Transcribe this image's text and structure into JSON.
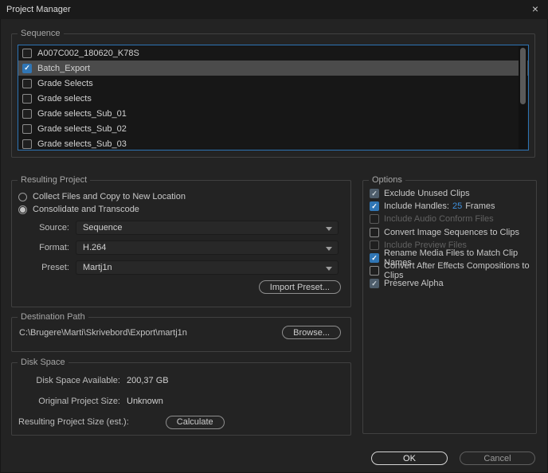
{
  "window": {
    "title": "Project Manager",
    "close_icon": "×"
  },
  "colors": {
    "accent": "#3076b5",
    "hot_text": "#3f90dd",
    "background": "#232323"
  },
  "sequence": {
    "label": "Sequence",
    "items": [
      {
        "label": "A007C002_180620_K78S",
        "checked": false,
        "selected": false
      },
      {
        "label": "Batch_Export",
        "checked": true,
        "selected": true
      },
      {
        "label": "Grade Selects",
        "checked": false,
        "selected": false
      },
      {
        "label": "Grade selects",
        "checked": false,
        "selected": false
      },
      {
        "label": "Grade selects_Sub_01",
        "checked": false,
        "selected": false
      },
      {
        "label": "Grade selects_Sub_02",
        "checked": false,
        "selected": false
      },
      {
        "label": "Grade selects_Sub_03",
        "checked": false,
        "selected": false
      }
    ]
  },
  "resulting_project": {
    "label": "Resulting Project",
    "radios": [
      {
        "label": "Collect Files and Copy to New Location",
        "selected": false
      },
      {
        "label": "Consolidate and Transcode",
        "selected": true
      }
    ],
    "fields": [
      {
        "label": "Source:",
        "value": "Sequence"
      },
      {
        "label": "Format:",
        "value": "H.264"
      },
      {
        "label": "Preset:",
        "value": "Martj1n"
      }
    ],
    "import_preset_label": "Import Preset..."
  },
  "options": {
    "label": "Options",
    "items": [
      {
        "label": "Exclude Unused Clips",
        "checked": true,
        "disabled": true
      },
      {
        "label": "Include Handles:",
        "checked": true,
        "disabled": false,
        "value": "25",
        "suffix": "Frames"
      },
      {
        "label": "Include Audio Conform Files",
        "checked": false,
        "disabled": true
      },
      {
        "label": "Convert Image Sequences to Clips",
        "checked": false,
        "disabled": false
      },
      {
        "label": "Include Preview Files",
        "checked": false,
        "disabled": true
      },
      {
        "label": "Rename Media Files to Match Clip Names",
        "checked": true,
        "disabled": false
      },
      {
        "label": "Convert After Effects Compositions to Clips",
        "checked": false,
        "disabled": false
      },
      {
        "label": "Preserve Alpha",
        "checked": true,
        "disabled": true
      }
    ]
  },
  "destination_path": {
    "label": "Destination Path",
    "path": "C:\\Brugere\\Marti\\Skrivebord\\Export\\martj1n",
    "browse_label": "Browse..."
  },
  "disk_space": {
    "label": "Disk Space",
    "rows": [
      {
        "label": "Disk Space Available:",
        "value": "200,37 GB"
      },
      {
        "label": "Original Project Size:",
        "value": "Unknown"
      },
      {
        "label": "Resulting Project Size (est.):",
        "value": ""
      }
    ],
    "calculate_label": "Calculate"
  },
  "footer": {
    "ok_label": "OK",
    "cancel_label": "Cancel"
  }
}
